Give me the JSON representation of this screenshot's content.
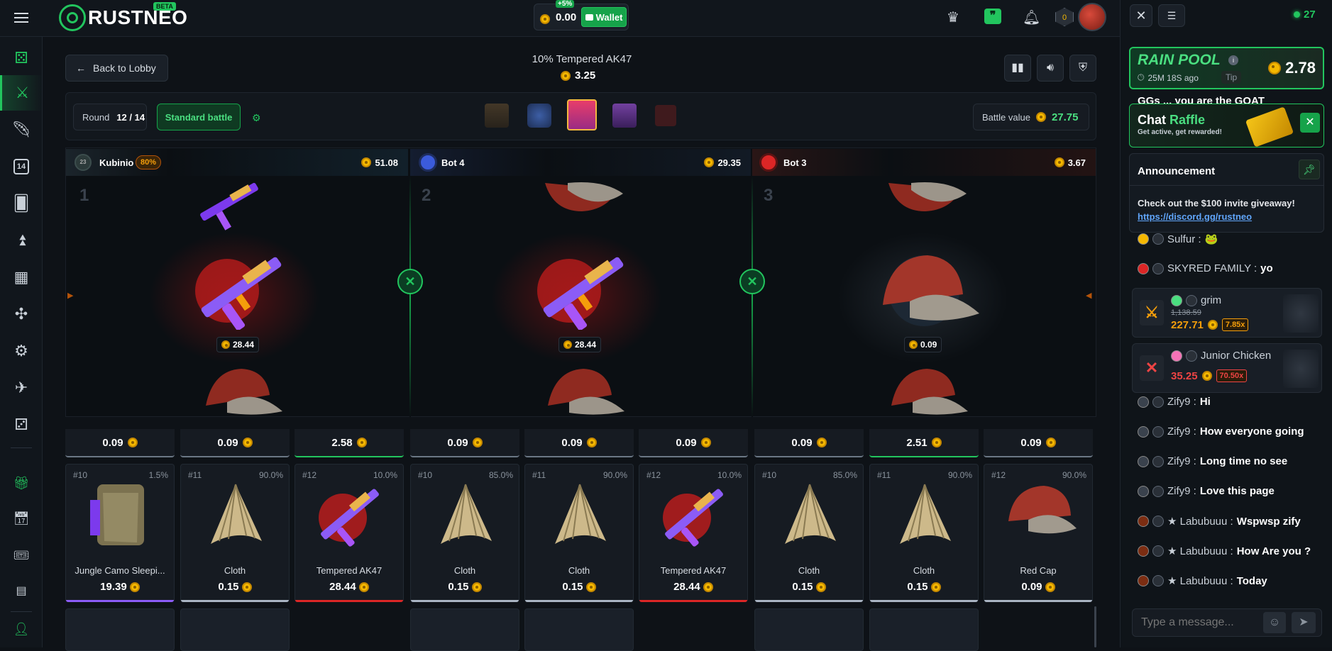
{
  "header": {
    "logo": "RUSTNEO",
    "beta": "BETA",
    "bonus": "+5%",
    "balance": "0.00",
    "wallet_label": "Wallet",
    "level": "0"
  },
  "chat_header": {
    "online": "27"
  },
  "battle": {
    "back_label": "Back to Lobby",
    "title": "10% Tempered AK47",
    "price": "3.25",
    "round_label": "Round",
    "round_value": "12 / 14",
    "mode": "Standard battle",
    "battle_value_label": "Battle value",
    "battle_value": "27.75"
  },
  "players": [
    {
      "name": "Kubinio",
      "badge": "80%",
      "total": "51.08",
      "slot": "1",
      "prize": "28.44",
      "avatar_level": "23"
    },
    {
      "name": "Bot 4",
      "total": "29.35",
      "slot": "2",
      "prize": "28.44"
    },
    {
      "name": "Bot 3",
      "total": "3.67",
      "slot": "3",
      "prize": "0.09"
    }
  ],
  "top_row": [
    {
      "value": "0.09",
      "bar": "#6b7785"
    },
    {
      "value": "0.09",
      "bar": "#6b7785"
    },
    {
      "value": "2.58",
      "bar": "#22c55e"
    },
    {
      "value": "0.09",
      "bar": "#6b7785"
    },
    {
      "value": "0.09",
      "bar": "#6b7785"
    },
    {
      "value": "0.09",
      "bar": "#6b7785"
    },
    {
      "value": "0.09",
      "bar": "#6b7785"
    },
    {
      "value": "2.51",
      "bar": "#22c55e"
    },
    {
      "value": "0.09",
      "bar": "#6b7785"
    }
  ],
  "items": [
    {
      "num": "#10",
      "pct": "1.5%",
      "name": "Jungle Camo Sleepi...",
      "price": "19.39",
      "type": "camo",
      "bar": "#8b5cf6"
    },
    {
      "num": "#11",
      "pct": "90.0%",
      "name": "Cloth",
      "price": "0.15",
      "type": "cloth",
      "bar": "#a9b4c2"
    },
    {
      "num": "#12",
      "pct": "10.0%",
      "name": "Tempered AK47",
      "price": "28.44",
      "type": "ak",
      "bar": "#dc2626"
    },
    {
      "num": "#10",
      "pct": "85.0%",
      "name": "Cloth",
      "price": "0.15",
      "type": "cloth",
      "bar": "#a9b4c2"
    },
    {
      "num": "#11",
      "pct": "90.0%",
      "name": "Cloth",
      "price": "0.15",
      "type": "cloth",
      "bar": "#a9b4c2"
    },
    {
      "num": "#12",
      "pct": "10.0%",
      "name": "Tempered AK47",
      "price": "28.44",
      "type": "ak",
      "bar": "#dc2626"
    },
    {
      "num": "#10",
      "pct": "85.0%",
      "name": "Cloth",
      "price": "0.15",
      "type": "cloth",
      "bar": "#a9b4c2"
    },
    {
      "num": "#11",
      "pct": "90.0%",
      "name": "Cloth",
      "price": "0.15",
      "type": "cloth",
      "bar": "#a9b4c2"
    },
    {
      "num": "#12",
      "pct": "90.0%",
      "name": "Red Cap",
      "price": "0.09",
      "type": "cap",
      "bar": "#a9b4c2"
    }
  ],
  "rain": {
    "title": "RAIN POOL",
    "time": "25M 18S ago",
    "tip": "Tip",
    "amount": "2.78"
  },
  "raffle": {
    "title_a": "Chat",
    "title_b": "Raffle",
    "sub": "Get active, get rewarded!"
  },
  "announcement": {
    "title": "Announcement",
    "text": "Check out the $100 invite giveaway!",
    "link": "https://discord.gg/rustneo"
  },
  "behind_text": "GGs ... you are the GOAT",
  "messages": [
    {
      "user": "Sulfur :",
      "text": "🐸"
    },
    {
      "user": "SKYRED FAMILY :",
      "text": "yo"
    }
  ],
  "wins": [
    {
      "user": "grim",
      "old": "1,138.59",
      "amount": "227.71",
      "mult": "7.85x",
      "color": "#f59e0b"
    },
    {
      "user": "Junior Chicken",
      "amount": "35.25",
      "mult": "70.50x",
      "color": "#ef4444"
    }
  ],
  "messages2": [
    {
      "user": "Zify9 :",
      "text": "Hi"
    },
    {
      "user": "Zify9 :",
      "text": "How everyone going"
    },
    {
      "user": "Zify9 :",
      "text": "Long time no see"
    },
    {
      "user": "Zify9 :",
      "text": "Love this page"
    },
    {
      "user": "★ Labubuuu :",
      "text": "Wspwsp zify"
    },
    {
      "user": "★ Labubuuu :",
      "text": "How Are you ?"
    },
    {
      "user": "★ Labubuuu :",
      "text": "Today"
    }
  ],
  "chat_input": {
    "placeholder": "Type a message..."
  },
  "colors": {
    "accent": "#22c55e",
    "coin": "#f5b800",
    "loss": "#dc2626"
  }
}
